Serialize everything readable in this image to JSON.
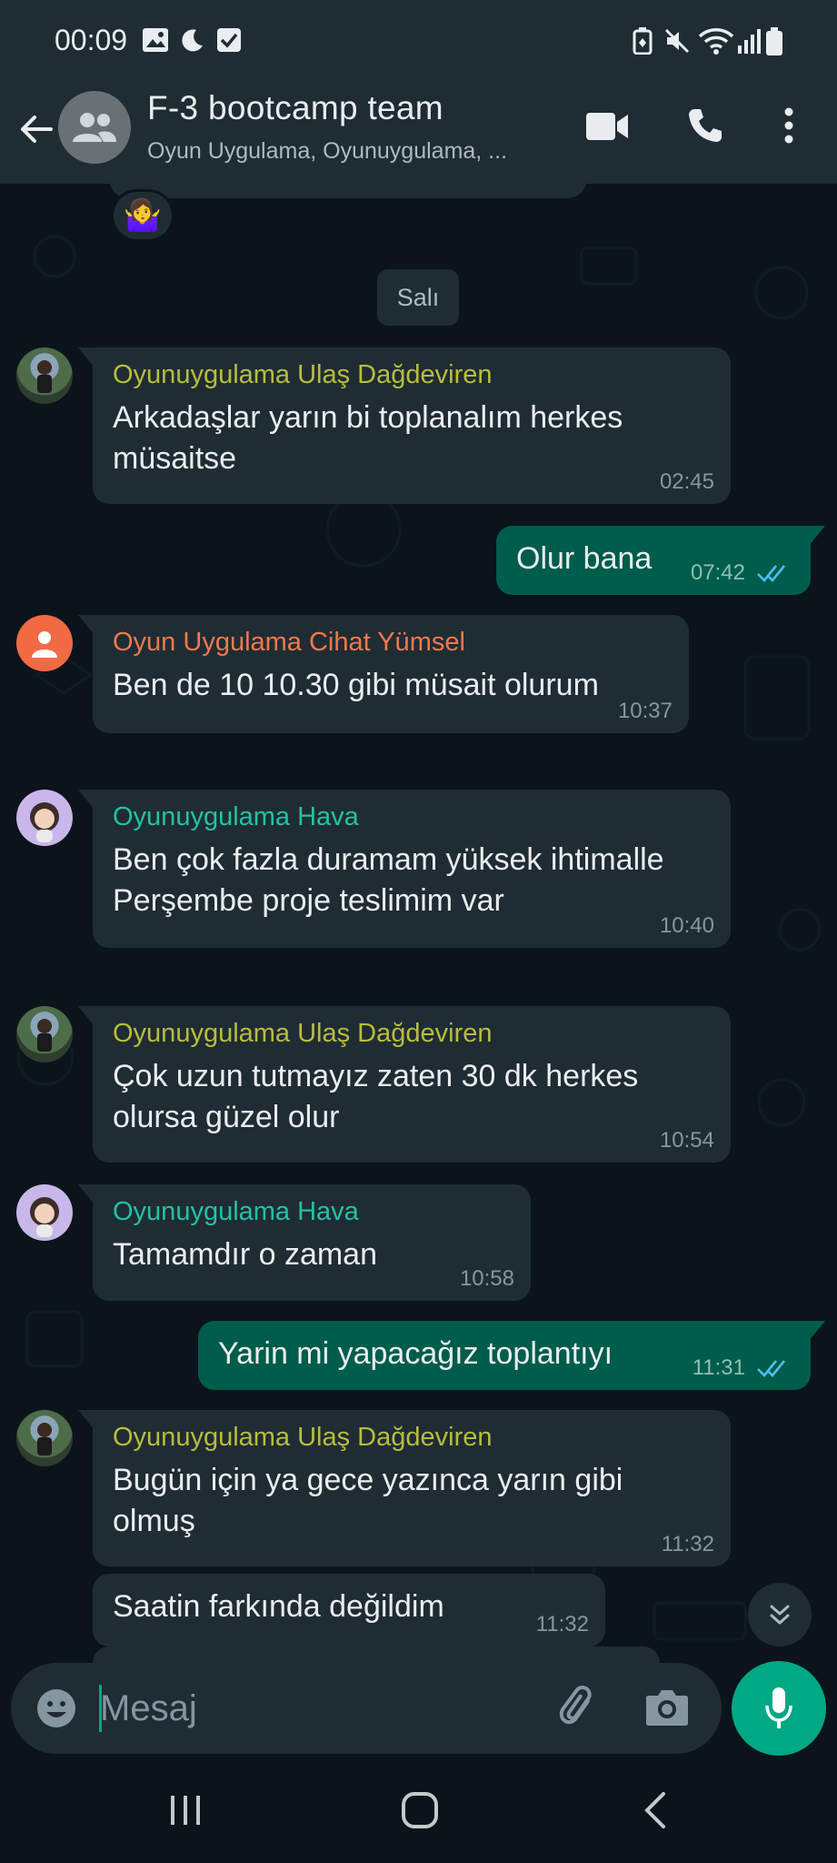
{
  "status_bar": {
    "time": "00:09"
  },
  "header": {
    "title": "F-3 bootcamp team",
    "subtitle": "Oyun Uygulama, Oyunuygulama, ..."
  },
  "chat": {
    "reaction_emoji": "🤷‍♀️",
    "date_label": "Salı",
    "messages": [
      {
        "sender": "Oyunuygulama Ulaş Dağdeviren",
        "sender_color": "#b7bd3e",
        "text": "Arkadaşlar yarın bi toplanalım herkes müsaitse",
        "time": "02:45",
        "outgoing": false
      },
      {
        "text": "Olur bana",
        "time": "07:42",
        "outgoing": true
      },
      {
        "sender": "Oyun Uygulama Cihat Yümsel",
        "sender_color": "#f0794e",
        "text": "Ben de 10 10.30 gibi müsait olurum",
        "time": "10:37",
        "outgoing": false
      },
      {
        "sender": "Oyunuygulama Hava",
        "sender_color": "#21c2a4",
        "text": "Ben çok fazla duramam yüksek ihtimalle Perşembe proje teslimim var",
        "time": "10:40",
        "outgoing": false
      },
      {
        "sender": "Oyunuygulama Ulaş Dağdeviren",
        "sender_color": "#b7bd3e",
        "text": "Çok uzun tutmayız zaten 30 dk herkes olursa güzel olur",
        "time": "10:54",
        "outgoing": false
      },
      {
        "sender": "Oyunuygulama Hava",
        "sender_color": "#21c2a4",
        "text": "Tamamdır o zaman",
        "time": "10:58",
        "outgoing": false
      },
      {
        "text": "Yarin mi yapacağız toplantıyı",
        "time": "11:31",
        "outgoing": true
      },
      {
        "sender": "Oyunuygulama Ulaş Dağdeviren",
        "sender_color": "#b7bd3e",
        "text": "Bugün için ya gece yazınca yarın gibi olmuş",
        "time": "11:32",
        "outgoing": false
      },
      {
        "text": "Saatin farkında değildim",
        "time": "11:32",
        "outgoing": false
      }
    ]
  },
  "input": {
    "placeholder": "Mesaj"
  },
  "colors": {
    "accent": "#00a884",
    "outgoing_bubble": "#005c4b",
    "incoming_bubble": "#202c33",
    "background": "#0b141a",
    "header": "#1f2c34",
    "read_ticks": "#53bdeb"
  },
  "icons": {
    "status": [
      "gallery-icon",
      "moon-icon",
      "checkbox-icon",
      "battery-saver-icon",
      "mute-icon",
      "wifi-icon",
      "signal-icon",
      "battery-icon"
    ],
    "header": [
      "back-arrow-icon",
      "group-icon",
      "video-call-icon",
      "voice-call-icon",
      "more-vert-icon"
    ],
    "input": [
      "emoji-icon",
      "attach-icon",
      "camera-icon",
      "mic-icon"
    ],
    "nav": [
      "recents-icon",
      "home-icon",
      "back-icon"
    ]
  }
}
